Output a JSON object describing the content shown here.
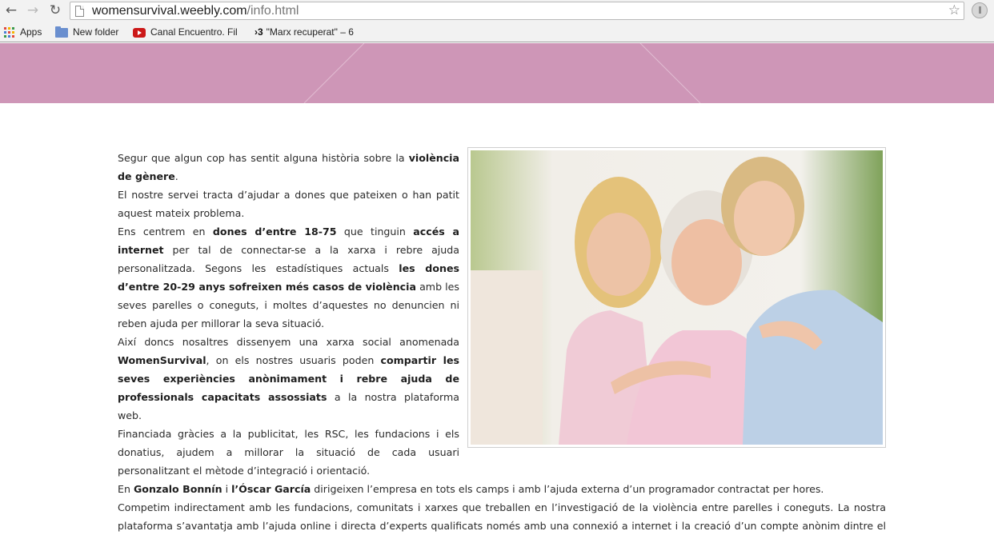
{
  "browser": {
    "url_host": "womensurvival.weebly.com",
    "url_path": "/info.html",
    "bookmarks": [
      {
        "label": "Apps",
        "icon": "apps-grid-icon"
      },
      {
        "label": "New folder",
        "icon": "folder-icon"
      },
      {
        "label": "Canal Encuentro. Fil",
        "icon": "youtube-icon"
      },
      {
        "label": "\"Marx recuperat\" – 6",
        "icon": "tv3-icon"
      }
    ]
  },
  "colors": {
    "banner": "#ce96b7",
    "text": "#2b2b2b"
  },
  "content": {
    "p1": [
      {
        "t": "Segur que algun cop has sentit alguna història sobre la "
      },
      {
        "t": "violència de gènere",
        "b": true
      },
      {
        "t": "."
      }
    ],
    "p2": [
      {
        "t": "El nostre servei tracta d’ajudar a dones que pateixen o han patit aquest mateix problema."
      }
    ],
    "p3": [
      {
        "t": "Ens centrem en "
      },
      {
        "t": "dones d’entre 18-75",
        "b": true
      },
      {
        "t": " que tinguin "
      },
      {
        "t": "accés a internet",
        "b": true
      },
      {
        "t": " per tal de connectar-se a la xarxa i rebre ajuda personalitzada. Segons les estadístiques actuals "
      },
      {
        "t": "les dones d’entre 20-29 anys sofreixen més casos de violència",
        "b": true
      },
      {
        "t": " amb les seves parelles o coneguts, i moltes d’aquestes no denuncien ni reben ajuda per millorar la seva situació."
      }
    ],
    "p4": [
      {
        "t": "Així doncs nosaltres dissenyem una xarxa social anomenada "
      },
      {
        "t": "WomenSurvival",
        "b": true
      },
      {
        "t": ", on els nostres usuaris poden "
      },
      {
        "t": "compartir les seves experiències anònimament i rebre ajuda de professionals capacitats assossiats",
        "b": true
      },
      {
        "t": " a la nostra plataforma web."
      }
    ],
    "p5": [
      {
        "t": "Financiada gràcies a la publicitat, les RSC, les fundacions i els donatius, ajudem a millorar la situació de cada usuari personalitzant el mètode d’integració i orientació."
      }
    ],
    "p6": [
      {
        "t": "En "
      },
      {
        "t": "Gonzalo Bonnín",
        "b": true
      },
      {
        "t": " i "
      },
      {
        "t": "l’Óscar García",
        "b": true
      },
      {
        "t": " dirigeixen l’empresa en tots els camps i amb l’ajuda externa d’un programador contractat per hores."
      }
    ],
    "p7": [
      {
        "t": "Competim indirectament amb les fundacions, comunitats i xarxes que treballen en l’investigació de la violència entre parelles i coneguts. La nostra plataforma s’avantatja amb l’ajuda online i directa d’experts qualificats només amb una connexió a internet i la creació d’un compte anònim dintre el nostre servidor."
      }
    ]
  }
}
